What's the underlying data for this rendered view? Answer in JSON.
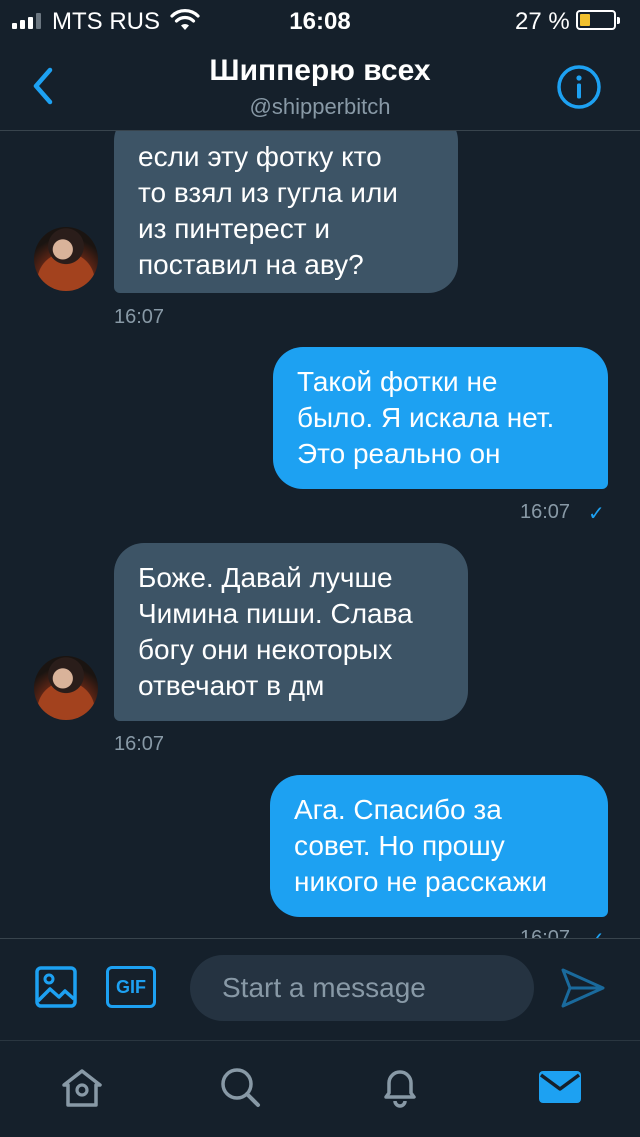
{
  "status_bar": {
    "carrier": "MTS RUS",
    "time": "16:08",
    "battery_percent": "27 %",
    "battery_level": 0.27,
    "signal_bars_on": 3
  },
  "header": {
    "title": "Шипперю всех",
    "handle": "@shipperbitch"
  },
  "messages": [
    {
      "side": "in",
      "lines": [
        "если эту фотку кто",
        "то взял из гугла или",
        "из пинтерест и",
        "поставил на аву?"
      ],
      "time": "16:07"
    },
    {
      "side": "out",
      "lines": [
        "Такой фотки не",
        "было. Я искала нет.",
        "Это реально он"
      ],
      "time": "16:07",
      "status": "✓"
    },
    {
      "side": "in",
      "lines": [
        "Боже. Давай лучше",
        "Чимина пиши. Слава",
        "богу они некоторых",
        "отвечают в дм"
      ],
      "time": "16:07"
    },
    {
      "side": "out",
      "lines": [
        "Ага. Спасибо за",
        "совет. Но прошу",
        "никого не расскажи"
      ],
      "time": "16:07",
      "status": "✓"
    }
  ],
  "composer": {
    "gif_label": "GIF",
    "placeholder": "Start a message"
  },
  "tabs": [
    {
      "name": "home-icon",
      "active": false
    },
    {
      "name": "search-icon",
      "active": false
    },
    {
      "name": "notifications-icon",
      "active": false
    },
    {
      "name": "messages-icon",
      "active": true
    }
  ],
  "colors": {
    "background": "#15202b",
    "accent": "#1da1f2",
    "incoming_bubble": "#3d5466",
    "muted_text": "#8899a6"
  }
}
